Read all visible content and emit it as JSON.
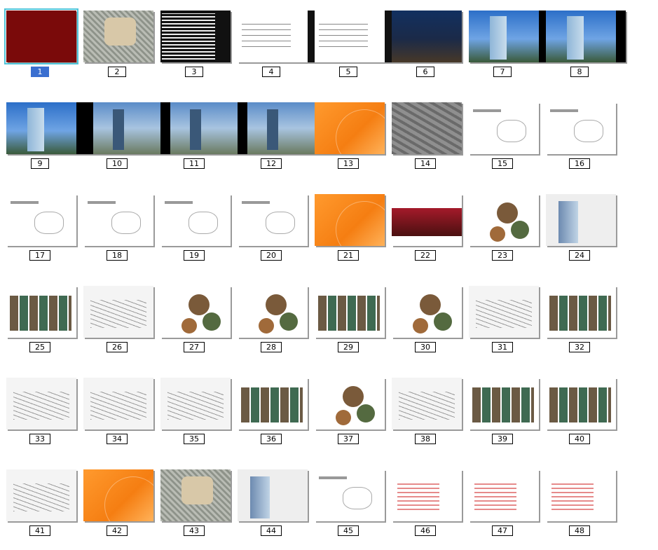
{
  "slides": [
    {
      "label": "1",
      "style": "t-dark",
      "selected": true
    },
    {
      "label": "2",
      "style": "t-map"
    },
    {
      "label": "3",
      "style": "t-bigtable"
    },
    {
      "label": "4",
      "style": "t-table"
    },
    {
      "label": "5",
      "style": "t-table"
    },
    {
      "label": "6",
      "style": "t-night"
    },
    {
      "label": "7",
      "style": "t-sky"
    },
    {
      "label": "8",
      "style": "t-sky"
    },
    {
      "label": "9",
      "style": "t-sky"
    },
    {
      "label": "10",
      "style": "t-city"
    },
    {
      "label": "11",
      "style": "t-city"
    },
    {
      "label": "12",
      "style": "t-city"
    },
    {
      "label": "13",
      "style": "t-orange"
    },
    {
      "label": "14",
      "style": "t-sat"
    },
    {
      "label": "15",
      "style": "t-white"
    },
    {
      "label": "16",
      "style": "t-white"
    },
    {
      "label": "17",
      "style": "t-white"
    },
    {
      "label": "18",
      "style": "t-white"
    },
    {
      "label": "19",
      "style": "t-white"
    },
    {
      "label": "20",
      "style": "t-white"
    },
    {
      "label": "21",
      "style": "t-orange"
    },
    {
      "label": "22",
      "style": "t-redbar"
    },
    {
      "label": "23",
      "style": "t-circles"
    },
    {
      "label": "24",
      "style": "t-render"
    },
    {
      "label": "25",
      "style": "t-photos"
    },
    {
      "label": "26",
      "style": "t-sketch"
    },
    {
      "label": "27",
      "style": "t-circles"
    },
    {
      "label": "28",
      "style": "t-circles"
    },
    {
      "label": "29",
      "style": "t-photos"
    },
    {
      "label": "30",
      "style": "t-circles"
    },
    {
      "label": "31",
      "style": "t-sketch"
    },
    {
      "label": "32",
      "style": "t-photos"
    },
    {
      "label": "33",
      "style": "t-sketch"
    },
    {
      "label": "34",
      "style": "t-sketch"
    },
    {
      "label": "35",
      "style": "t-sketch"
    },
    {
      "label": "36",
      "style": "t-photos"
    },
    {
      "label": "37",
      "style": "t-circles"
    },
    {
      "label": "38",
      "style": "t-sketch"
    },
    {
      "label": "39",
      "style": "t-photos"
    },
    {
      "label": "40",
      "style": "t-photos"
    },
    {
      "label": "41",
      "style": "t-sketch"
    },
    {
      "label": "42",
      "style": "t-orange"
    },
    {
      "label": "43",
      "style": "t-map"
    },
    {
      "label": "44",
      "style": "t-render"
    },
    {
      "label": "45",
      "style": "t-white"
    },
    {
      "label": "46",
      "style": "t-chart"
    },
    {
      "label": "47",
      "style": "t-chart"
    },
    {
      "label": "48",
      "style": "t-chart"
    }
  ]
}
